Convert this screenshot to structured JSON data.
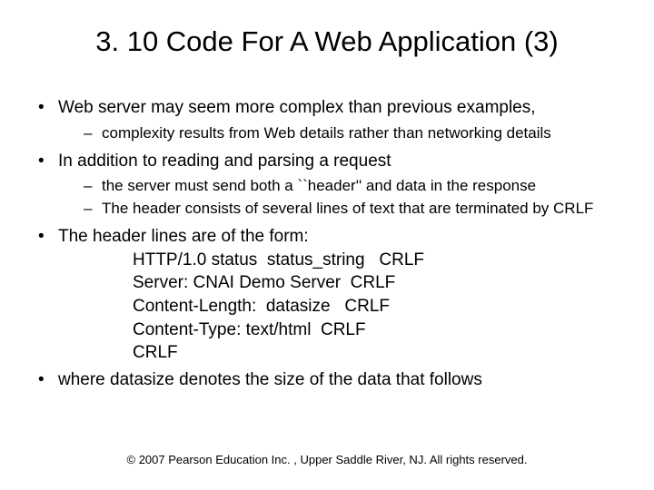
{
  "title": "3. 10 Code For A Web Application (3)",
  "bullets": {
    "b1": "Web server may seem more complex than previous examples,",
    "b1s1": "complexity results from Web details rather than networking details",
    "b2": "In addition to reading and parsing a request",
    "b2s1": "the server must send both a ``header'' and data in the response",
    "b2s2": "The header consists of several lines of text that are terminated by CRLF",
    "b3": "The header lines are of the form:",
    "h1": "HTTP/1.0 status  status_string   CRLF",
    "h2": "Server: CNAI Demo Server  CRLF",
    "h3": "Content-Length:  datasize   CRLF",
    "h4": "Content-Type: text/html  CRLF",
    "h5": "CRLF",
    "b4": "where  datasize  denotes the size of the data that follows"
  },
  "footer": "© 2007 Pearson Education Inc. , Upper Saddle River, NJ. All rights reserved."
}
